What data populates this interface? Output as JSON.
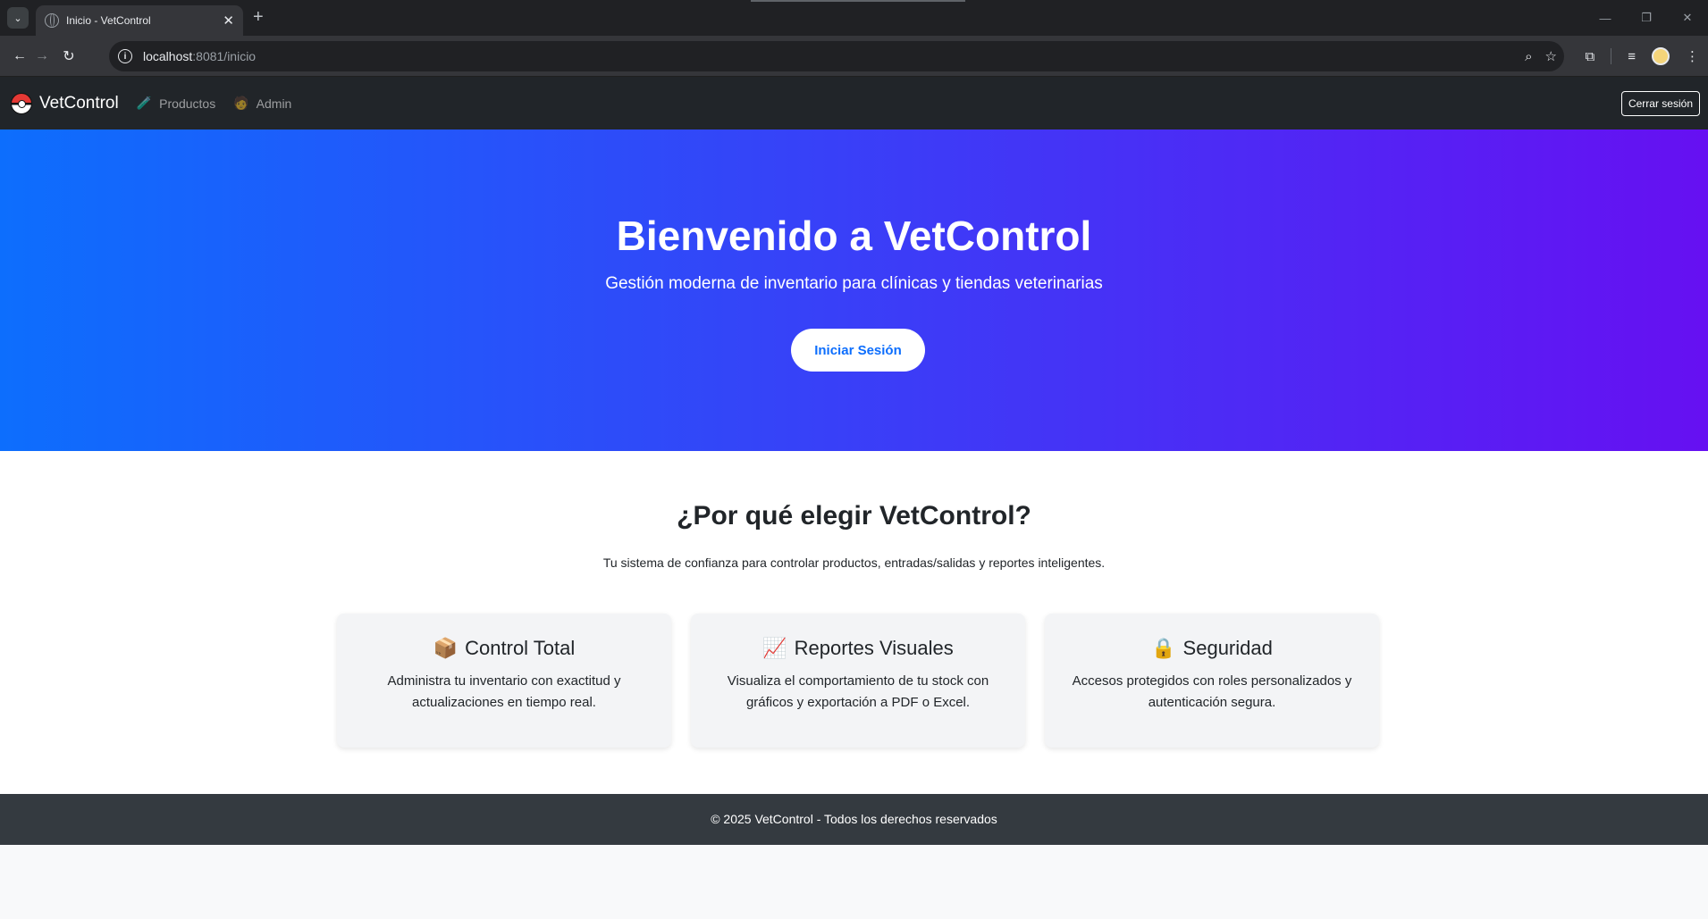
{
  "browser": {
    "tab_title": "Inicio - VetControl",
    "tab_close": "✕",
    "new_tab": "+",
    "url_host": "localhost",
    "url_rest": ":8081/inicio"
  },
  "navbar": {
    "brand": "VetControl",
    "links": [
      {
        "icon": "🧪",
        "label": "Productos"
      },
      {
        "icon": "🧑",
        "label": "Admin"
      }
    ],
    "logout_label": "Cerrar sesión"
  },
  "hero": {
    "title": "Bienvenido a VetControl",
    "subtitle": "Gestión moderna de inventario para clínicas y tiendas veterinarias",
    "button_label": "Iniciar Sesión"
  },
  "features": {
    "title": "¿Por qué elegir VetControl?",
    "subtitle": "Tu sistema de confianza para controlar productos, entradas/salidas y reportes inteligentes.",
    "cards": [
      {
        "icon": "📦",
        "title": "Control Total",
        "text": "Administra tu inventario con exactitud y actualizaciones en tiempo real."
      },
      {
        "icon": "📈",
        "title": "Reportes Visuales",
        "text": "Visualiza el comportamiento de tu stock con gráficos y exportación a PDF o Excel."
      },
      {
        "icon": "🔒",
        "title": "Seguridad",
        "text": "Accesos protegidos con roles personalizados y autenticación segura."
      }
    ]
  },
  "footer": {
    "text": "© 2025 VetControl - Todos los derechos reservados"
  },
  "colors": {
    "hero_start": "#0d6efd",
    "hero_end": "#6610f2",
    "navbar_bg": "#212529",
    "footer_bg": "#343a40",
    "primary": "#0d6efd"
  }
}
